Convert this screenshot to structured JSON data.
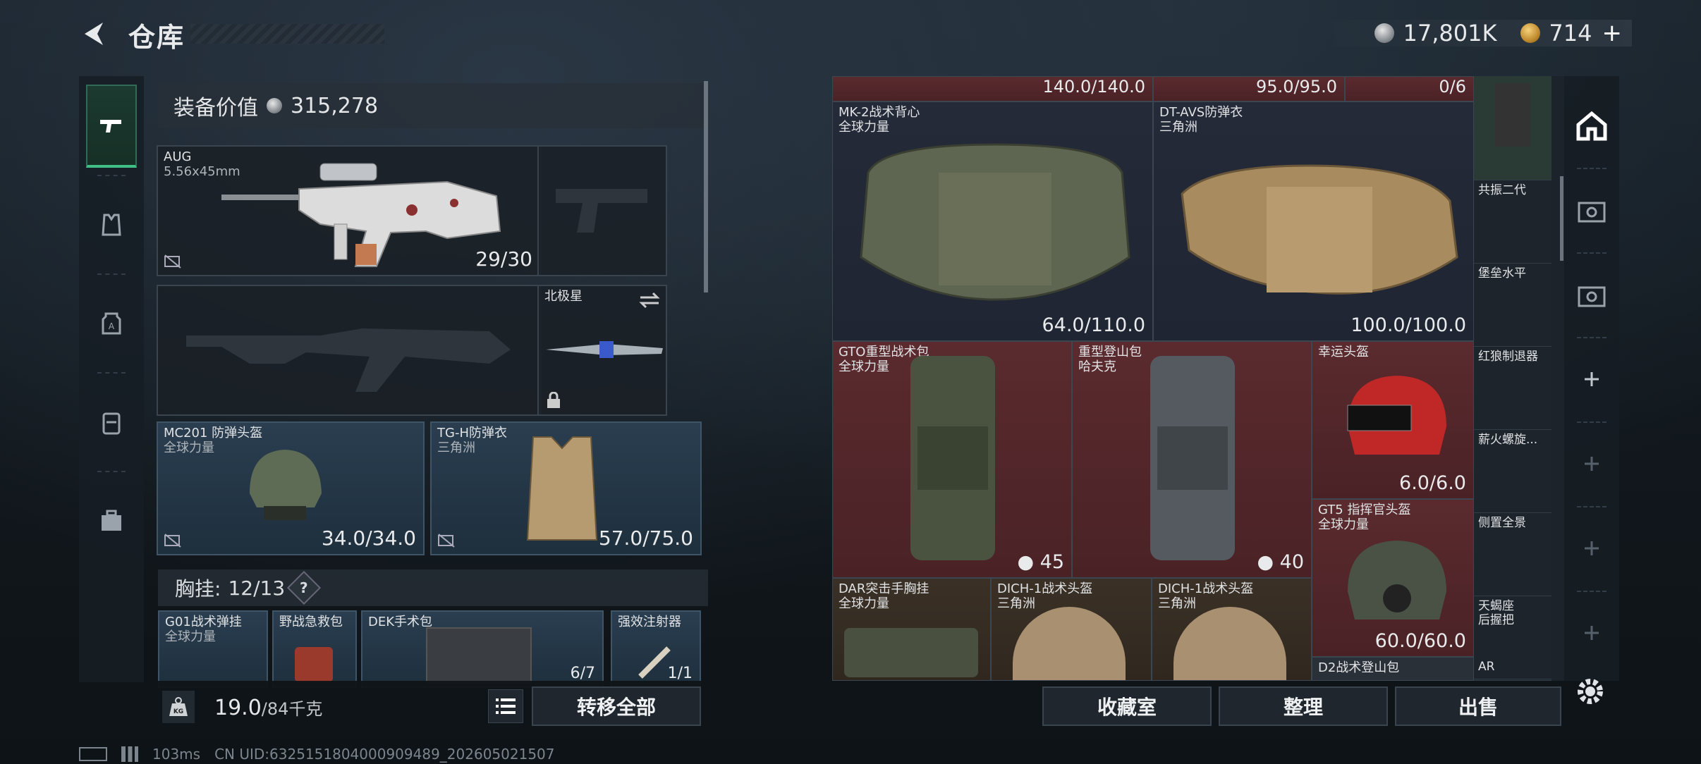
{
  "header": {
    "title": "仓库",
    "currency_silver": "17,801K",
    "currency_gold": "714",
    "plus": "+"
  },
  "equipment": {
    "value_label": "装备价值",
    "value": "315,278",
    "primary_weapon": {
      "name": "AUG",
      "ammo": "5.56x45mm",
      "value": "29/30"
    },
    "melee": {
      "name": "北极星"
    },
    "helmet": {
      "name": "MC201 防弹头盔",
      "sub": "全球力量",
      "value": "34.0/34.0"
    },
    "armor": {
      "name": "TG-H防弹衣",
      "sub": "三角洲",
      "value": "57.0/75.0"
    },
    "chest": {
      "label": "胸挂:",
      "count": "12/13",
      "help": "?"
    },
    "chest_items": [
      {
        "name": "G01战术弹挂",
        "sub": "全球力量"
      },
      {
        "name": "野战急救包",
        "sub": ""
      },
      {
        "name": "DEK手术包",
        "sub": "",
        "value": "6/7"
      },
      {
        "name": "强效注射器",
        "sub": "",
        "value": "1/1"
      }
    ]
  },
  "bottom_left": {
    "kg": "KG",
    "weight": "19.0",
    "weight_cap": "/84千克",
    "transfer_all": "转移全部"
  },
  "stash": {
    "top_row": [
      {
        "value": "140.0/140.0"
      },
      {
        "value": "95.0/95.0"
      },
      {
        "value": "0/6"
      }
    ],
    "items": [
      {
        "name": "MK-2战术背心",
        "sub": "全球力量",
        "value": "64.0/110.0"
      },
      {
        "name": "DT-AVS防弹衣",
        "sub": "三角洲",
        "value": "100.0/100.0"
      },
      {
        "name": "GTO重型战术包",
        "sub": "全球力量",
        "value": "45"
      },
      {
        "name": "重型登山包",
        "sub": "哈夫克",
        "value": "40"
      },
      {
        "name": "幸运头盔",
        "sub": "",
        "value": "6.0/6.0"
      },
      {
        "name": "GT5 指挥官头盔",
        "sub": "全球力量",
        "value": "60.0/60.0"
      },
      {
        "name": "DAR突击手胸挂",
        "sub": "全球力量"
      },
      {
        "name": "DICH-1战术头盔",
        "sub": "三角洲"
      },
      {
        "name": "DICH-1战术头盔",
        "sub": "三角洲"
      },
      {
        "name": "D2战术登山包",
        "sub": ""
      }
    ],
    "side_items": [
      "共振二代",
      "堡垒水平",
      "红狼制退器",
      "薪火螺旋...",
      "侧置全景",
      "天蝎座\n后握把",
      "AR"
    ]
  },
  "actions": {
    "collection": "收藏室",
    "sort": "整理",
    "sell": "出售"
  },
  "status": {
    "ping": "103ms",
    "uid": "CN UID:6325151804000909489_202605021507"
  },
  "colors": {
    "accent_green": "#3fbf85",
    "red_cell": "#5a2a2e",
    "blue_slot": "#2a3e50"
  }
}
